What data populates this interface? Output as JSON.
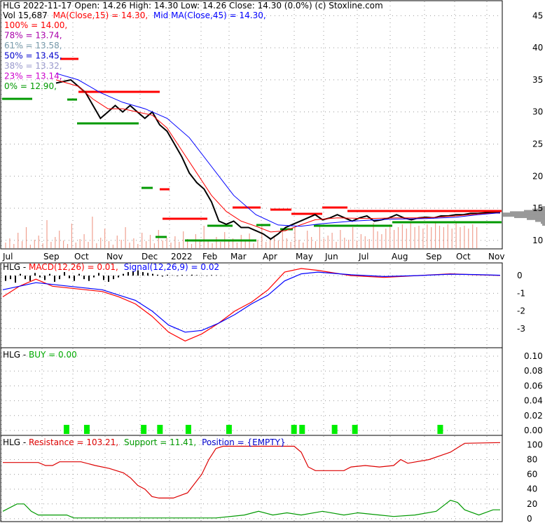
{
  "header": {
    "line1": "HLG  2022-11-17 Open: 14.26  High: 14.30  Low: 14.26  Close: 14.30 (0.0%)  (c) Stoxline.com",
    "vol_label": "Vol 15,687",
    "ma15": "MA(Close,15) = 14.30,",
    "ma45": "Mid MA(Close,45) = 14.30,"
  },
  "fib_levels": [
    {
      "label": "100% = 14.00,",
      "color": "#ff0000"
    },
    {
      "label": "78% = 13.74,",
      "color": "#aa00aa"
    },
    {
      "label": "61% = 13.58,",
      "color": "#7799aa"
    },
    {
      "label": "50% = 13.45,",
      "color": "#0000cc"
    },
    {
      "label": "38% = 13.32,",
      "color": "#9999cc"
    },
    {
      "label": "23% = 13.14,",
      "color": "#cc00cc"
    },
    {
      "label": "0% = 12.90,",
      "color": "#009900"
    }
  ],
  "macd_panel": {
    "prefix": "HLG - ",
    "macd": "MACD(12,26) = 0.01,",
    "signal": "Signal(12,26,9) = 0.02"
  },
  "buy_panel": {
    "prefix": "HLG - ",
    "buy": "BUY = 0.00"
  },
  "rs_panel": {
    "prefix": "HLG - ",
    "resistance": "Resistance = 103.21,",
    "support": "Support = 11.41,",
    "position": "Position = {EMPTY}"
  },
  "colors": {
    "price": "#000000",
    "ma_short": "#ff0000",
    "ma_mid": "#0000ff",
    "volume": "#f0a090",
    "macd": "#ff0000",
    "signal": "#0000ff",
    "histogram": "#000000",
    "buy": "#00ee00",
    "resistance": "#dd0000",
    "support": "#009900",
    "level_red": "#ff0000",
    "level_green": "#009900",
    "grid": "#999999"
  },
  "chart_data": [
    {
      "type": "line",
      "title": "HLG  2022-11-17 Open: 14.26  High: 14.30  Low: 14.26  Close: 14.30 (0.0%)  (c) Stoxline.com",
      "x_ticks": [
        "Jul",
        "Sep",
        "Oct",
        "Nov",
        "Dec",
        "2022",
        "Feb",
        "Mar",
        "Apr",
        "May",
        "Jun",
        "Jul",
        "Aug",
        "Sep",
        "Oct",
        "Nov"
      ],
      "y_ticks": [
        10,
        15,
        20,
        25,
        30,
        35,
        40,
        45
      ],
      "ylim": [
        9,
        47
      ],
      "series": [
        {
          "name": "Close",
          "points": [
            [
              0,
              34.5
            ],
            [
              4,
              35
            ],
            [
              8,
              33
            ],
            [
              10,
              31
            ],
            [
              12,
              29
            ],
            [
              14,
              30
            ],
            [
              16,
              31
            ],
            [
              18,
              30
            ],
            [
              20,
              31
            ],
            [
              22,
              30
            ],
            [
              24,
              29
            ],
            [
              26,
              30
            ],
            [
              28,
              28
            ],
            [
              30,
              27
            ],
            [
              32,
              25
            ],
            [
              34,
              23
            ],
            [
              36,
              20.5
            ],
            [
              38,
              19
            ],
            [
              40,
              18
            ],
            [
              42,
              16
            ],
            [
              44,
              13
            ],
            [
              46,
              12.5
            ],
            [
              48,
              13
            ],
            [
              50,
              12
            ],
            [
              52,
              12
            ],
            [
              54,
              11.5
            ],
            [
              56,
              11
            ],
            [
              58,
              10.2
            ],
            [
              60,
              11
            ],
            [
              62,
              12
            ],
            [
              64,
              12.5
            ],
            [
              66,
              13
            ],
            [
              68,
              13.5
            ],
            [
              70,
              14
            ],
            [
              72,
              13.2
            ],
            [
              74,
              13.5
            ],
            [
              76,
              14
            ],
            [
              78,
              13.5
            ],
            [
              80,
              13
            ],
            [
              82,
              13.5
            ],
            [
              84,
              13.8
            ],
            [
              86,
              13
            ],
            [
              88,
              13.2
            ],
            [
              90,
              13.5
            ],
            [
              92,
              14
            ],
            [
              94,
              13.5
            ],
            [
              96,
              13.2
            ],
            [
              98,
              13.5
            ],
            [
              100,
              13.6
            ],
            [
              102,
              13.5
            ],
            [
              104,
              13.8
            ],
            [
              106,
              13.8
            ],
            [
              108,
              14
            ],
            [
              110,
              14
            ],
            [
              112,
              14.2
            ],
            [
              114,
              14.2
            ],
            [
              116,
              14.3
            ],
            [
              118,
              14.3
            ],
            [
              120,
              14.3
            ]
          ]
        },
        {
          "name": "MA(Close,15)",
          "points": [
            [
              0,
              35
            ],
            [
              6,
              34
            ],
            [
              10,
              32
            ],
            [
              14,
              30.5
            ],
            [
              18,
              30.5
            ],
            [
              22,
              30
            ],
            [
              26,
              29.5
            ],
            [
              30,
              27.5
            ],
            [
              34,
              24
            ],
            [
              38,
              20.5
            ],
            [
              42,
              17
            ],
            [
              46,
              14.5
            ],
            [
              50,
              13
            ],
            [
              54,
              12.2
            ],
            [
              58,
              11.3
            ],
            [
              62,
              11.5
            ],
            [
              66,
              12.4
            ],
            [
              70,
              13.2
            ],
            [
              76,
              13.5
            ],
            [
              84,
              13.4
            ],
            [
              92,
              13.5
            ],
            [
              100,
              13.5
            ],
            [
              108,
              13.8
            ],
            [
              114,
              14.1
            ],
            [
              120,
              14.3
            ]
          ]
        },
        {
          "name": "Mid MA(Close,45)",
          "points": [
            [
              0,
              36
            ],
            [
              6,
              35
            ],
            [
              12,
              33
            ],
            [
              18,
              31.5
            ],
            [
              24,
              30.5
            ],
            [
              30,
              29
            ],
            [
              36,
              26
            ],
            [
              42,
              21.5
            ],
            [
              48,
              17
            ],
            [
              54,
              14
            ],
            [
              60,
              12.4
            ],
            [
              66,
              12.2
            ],
            [
              72,
              12.6
            ],
            [
              80,
              13
            ],
            [
              90,
              13.3
            ],
            [
              100,
              13.4
            ],
            [
              108,
              13.6
            ],
            [
              114,
              14
            ],
            [
              120,
              14.3
            ]
          ]
        }
      ]
    },
    {
      "type": "line",
      "title": "HLG - MACD(12,26) = 0.01, Signal(12,26,9) = 0.02",
      "y_ticks": [
        -3,
        -2,
        -1,
        0
      ],
      "ylim": [
        -4,
        0.6
      ],
      "series": [
        {
          "name": "MACD(12,26)",
          "points": [
            [
              0,
              -1.2
            ],
            [
              4,
              -0.6
            ],
            [
              8,
              -0.2
            ],
            [
              12,
              -0.6
            ],
            [
              16,
              -0.7
            ],
            [
              20,
              -0.8
            ],
            [
              24,
              -0.9
            ],
            [
              28,
              -1.2
            ],
            [
              32,
              -1.6
            ],
            [
              36,
              -2.3
            ],
            [
              40,
              -3.2
            ],
            [
              44,
              -3.7
            ],
            [
              48,
              -3.3
            ],
            [
              52,
              -2.7
            ],
            [
              56,
              -2.0
            ],
            [
              60,
              -1.5
            ],
            [
              64,
              -0.8
            ],
            [
              68,
              0.2
            ],
            [
              72,
              0.4
            ],
            [
              76,
              0.3
            ],
            [
              84,
              0.0
            ],
            [
              92,
              -0.1
            ],
            [
              100,
              0.0
            ],
            [
              108,
              0.1
            ],
            [
              114,
              0.05
            ],
            [
              120,
              0.01
            ]
          ]
        },
        {
          "name": "Signal(12,26,9)",
          "points": [
            [
              0,
              -0.8
            ],
            [
              4,
              -0.6
            ],
            [
              8,
              -0.4
            ],
            [
              12,
              -0.5
            ],
            [
              16,
              -0.6
            ],
            [
              20,
              -0.7
            ],
            [
              24,
              -0.8
            ],
            [
              28,
              -1.1
            ],
            [
              32,
              -1.4
            ],
            [
              36,
              -2.0
            ],
            [
              40,
              -2.8
            ],
            [
              44,
              -3.2
            ],
            [
              48,
              -3.1
            ],
            [
              52,
              -2.7
            ],
            [
              56,
              -2.2
            ],
            [
              60,
              -1.6
            ],
            [
              64,
              -1.1
            ],
            [
              68,
              -0.3
            ],
            [
              72,
              0.1
            ],
            [
              76,
              0.2
            ],
            [
              84,
              0.05
            ],
            [
              92,
              -0.05
            ],
            [
              100,
              0.0
            ],
            [
              108,
              0.08
            ],
            [
              114,
              0.06
            ],
            [
              120,
              0.02
            ]
          ]
        }
      ]
    },
    {
      "type": "bar",
      "title": "HLG - BUY = 0.00",
      "y_ticks": [
        0.0,
        0.02,
        0.04,
        0.06,
        0.08,
        0.1
      ],
      "buy_signal_x": [
        15,
        20,
        34,
        38,
        45,
        55,
        71,
        73,
        81,
        86,
        107
      ]
    },
    {
      "type": "line",
      "title": "HLG - Resistance = 103.21, Support = 11.41, Position = {EMPTY}",
      "y_ticks": [
        0,
        20,
        40,
        60,
        80,
        100
      ],
      "ylim": [
        -2,
        108
      ],
      "series": [
        {
          "name": "Resistance",
          "points": [
            [
              0,
              76
            ],
            [
              10,
              76
            ],
            [
              12,
              72
            ],
            [
              14,
              72
            ],
            [
              16,
              77
            ],
            [
              22,
              77
            ],
            [
              26,
              72
            ],
            [
              30,
              68
            ],
            [
              34,
              62
            ],
            [
              36,
              55
            ],
            [
              38,
              45
            ],
            [
              40,
              40
            ],
            [
              42,
              30
            ],
            [
              44,
              28
            ],
            [
              48,
              28
            ],
            [
              52,
              35
            ],
            [
              56,
              60
            ],
            [
              58,
              80
            ],
            [
              60,
              95
            ],
            [
              62,
              98
            ],
            [
              70,
              98
            ],
            [
              76,
              98
            ],
            [
              82,
              98
            ],
            [
              84,
              90
            ],
            [
              86,
              70
            ],
            [
              88,
              65
            ],
            [
              96,
              65
            ],
            [
              98,
              70
            ],
            [
              102,
              72
            ],
            [
              106,
              70
            ],
            [
              110,
              72
            ],
            [
              112,
              80
            ],
            [
              114,
              75
            ],
            [
              120,
              80
            ],
            [
              126,
              90
            ],
            [
              130,
              102
            ],
            [
              140,
              103
            ]
          ]
        },
        {
          "name": "Support",
          "points": [
            [
              0,
              10
            ],
            [
              4,
              20
            ],
            [
              6,
              20
            ],
            [
              8,
              10
            ],
            [
              10,
              5
            ],
            [
              14,
              5
            ],
            [
              18,
              5
            ],
            [
              20,
              1
            ],
            [
              30,
              1
            ],
            [
              40,
              1
            ],
            [
              50,
              1
            ],
            [
              60,
              1
            ],
            [
              68,
              5
            ],
            [
              72,
              10
            ],
            [
              76,
              5
            ],
            [
              80,
              8
            ],
            [
              84,
              5
            ],
            [
              90,
              10
            ],
            [
              96,
              5
            ],
            [
              100,
              8
            ],
            [
              106,
              5
            ],
            [
              110,
              3
            ],
            [
              116,
              5
            ],
            [
              122,
              10
            ],
            [
              126,
              25
            ],
            [
              128,
              22
            ],
            [
              130,
              12
            ],
            [
              134,
              5
            ],
            [
              138,
              12
            ],
            [
              140,
              12
            ]
          ]
        }
      ]
    }
  ]
}
